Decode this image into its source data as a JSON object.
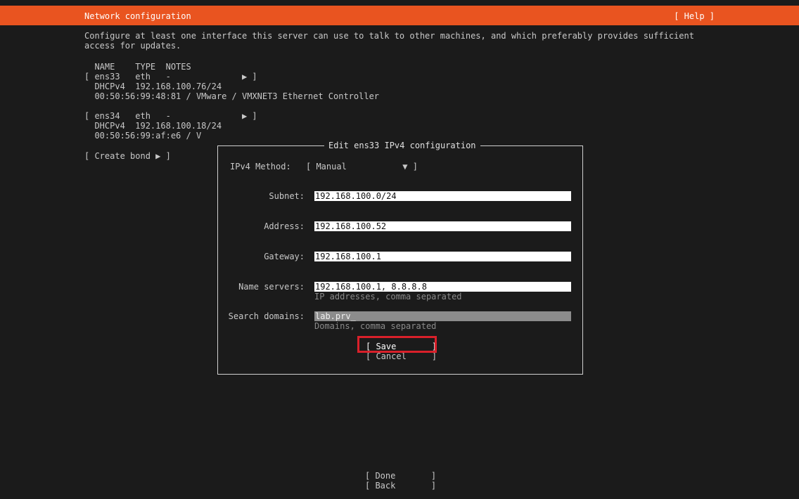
{
  "header": {
    "title": "Network configuration",
    "help_label": "[ Help ]",
    "bar_color": "#e95420"
  },
  "intro": "Configure at least one interface this server can use to talk to other machines, and which preferably provides sufficient access for updates.",
  "interfaces_header": "  NAME    TYPE  NOTES",
  "interfaces": [
    {
      "row": "[ ens33   eth   -              ▶ ]",
      "address": "  DHCPv4  192.168.100.76/24",
      "hw": "  00:50:56:99:48:81 / VMware / VMXNET3 Ethernet Controller"
    },
    {
      "row": "[ ens34   eth   -              ▶ ]",
      "address": "  DHCPv4  192.168.100.18/24",
      "hw": "  00:50:56:99:af:e6 / V"
    }
  ],
  "create_bond": "[ Create bond ▶ ]",
  "dialog": {
    "title": "Edit ens33 IPv4 configuration",
    "method_label": "IPv4 Method:",
    "method_value": "[ Manual           ▼ ]",
    "fields": {
      "subnet": {
        "label": "Subnet:",
        "value": "192.168.100.0/24"
      },
      "address": {
        "label": "Address:",
        "value": "192.168.100.52"
      },
      "gateway": {
        "label": "Gateway:",
        "value": "192.168.100.1"
      },
      "nameservers": {
        "label": "Name servers:",
        "value": "192.168.100.1, 8.8.8.8",
        "hint": "IP addresses, comma separated"
      },
      "search": {
        "label": "Search domains:",
        "value": "lab.prv_",
        "hint": "Domains, comma separated"
      }
    },
    "save_label": "[ Save       ]",
    "cancel_label": "[ Cancel     ]"
  },
  "footer": {
    "done_label": "[ Done       ]",
    "back_label": "[ Back       ]"
  },
  "highlight_color": "#d9202a"
}
